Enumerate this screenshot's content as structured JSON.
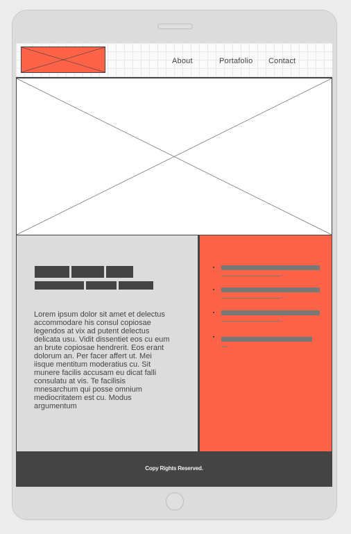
{
  "nav": {
    "items": [
      {
        "label": "About"
      },
      {
        "label": "Portafolio"
      },
      {
        "label": "Contact"
      }
    ]
  },
  "content": {
    "body": "Lorem ipsum dolor sit amet et delectus accommodare his consul copiosae legendos at vix ad putent delectus delicata usu. Vidit dissentiet eos cu eum an brute copiosae hendrerit. Eos erant dolorum an. Per facer affert ut. Mei iisque mentitum moderatius cu. Sit munere facilis accusam eu dicat falli consulatu at vis. Te facilisis mnesarchum qui posse omnium mediocritatem est cu. Modus argumentum"
  },
  "footer": {
    "copyright": "Copy Rights Reserved."
  },
  "colors": {
    "accent": "#ff6347",
    "dark": "#444444",
    "panel": "#dcdcdc",
    "device": "#dcdcdc",
    "background": "#ececec"
  }
}
